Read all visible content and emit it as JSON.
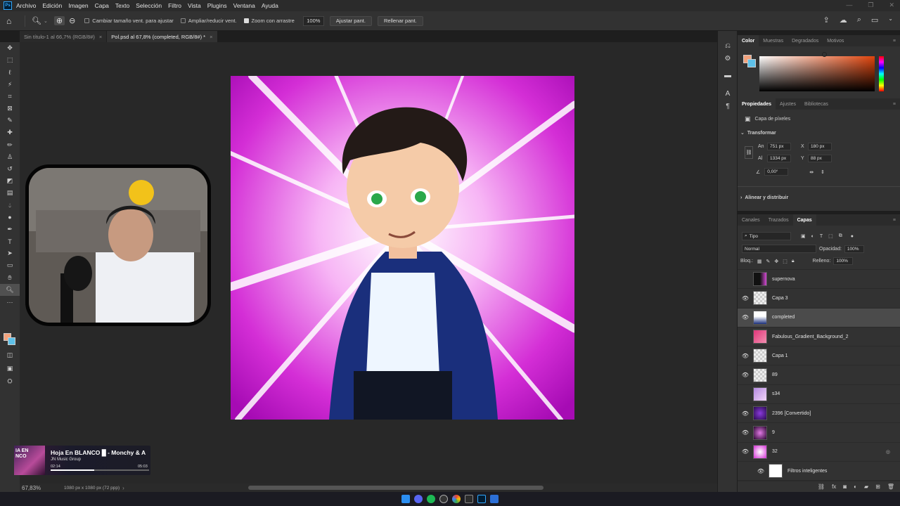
{
  "app": {
    "menu": [
      "Archivo",
      "Edición",
      "Imagen",
      "Capa",
      "Texto",
      "Selección",
      "Filtro",
      "Vista",
      "Plugins",
      "Ventana",
      "Ayuda"
    ]
  },
  "options": {
    "resize_windows": "Cambiar tamaño vent. para ajustar",
    "zoom_all": "Ampliar/reducir vent.",
    "scrubby_zoom": "Zoom con arrastre",
    "zoom_value": "100%",
    "fit_screen": "Ajustar pant.",
    "fill_screen": "Rellenar pant."
  },
  "tabs": [
    {
      "label": "Sin título-1 al 66,7% (RGB/8#)"
    },
    {
      "label": "Pol.psd al 67,8% (completed, RGB/8#) *"
    }
  ],
  "status": {
    "zoom": "67,83%",
    "dims": "1080 px x 1080 px (72 ppp)"
  },
  "music": {
    "song": "Hoja En BLANCO █ - Monchy & A",
    "artist": "JN Music Group",
    "elapsed": "02:14",
    "total": "05:03",
    "art_text": "IA EN\nNCO",
    "progress": 0.44
  },
  "color_panel": {
    "tabs": [
      "Color",
      "Muestras",
      "Degradados",
      "Motivos"
    ],
    "fg": "#f2a27c",
    "bg": "#5ec0e8"
  },
  "properties": {
    "tabs": [
      "Propiedades",
      "Ajustes",
      "Bibliotecas"
    ],
    "layer_kind": "Capa de píxeles",
    "transform_title": "Transformar",
    "w_label": "An",
    "w": "751 px",
    "x_label": "X",
    "x": "180 px",
    "h_label": "Al",
    "h": "1334 px",
    "y_label": "Y",
    "y": "88 px",
    "angle": "0,00°",
    "align_title": "Alinear y distribuir"
  },
  "layers_panel": {
    "tabs": [
      "Canales",
      "Trazados",
      "Capas"
    ],
    "filter": "Tipo",
    "blend": "Normal",
    "opacity_label": "Opacidad:",
    "opacity": "100%",
    "lock_label": "Bloq.:",
    "fill_label": "Relleno:",
    "fill": "100%",
    "layers": [
      {
        "name": "supernova",
        "visible": false
      },
      {
        "name": "Capa 3",
        "visible": true
      },
      {
        "name": "completed",
        "visible": true,
        "selected": true
      },
      {
        "name": "Fabulous_Gradient_Background_2",
        "visible": false
      },
      {
        "name": "Capa 1",
        "visible": true
      },
      {
        "name": "89",
        "visible": true
      },
      {
        "name": "s34",
        "visible": false
      },
      {
        "name": "2396 [Convertido]",
        "visible": true
      },
      {
        "name": "9",
        "visible": true
      },
      {
        "name": "32",
        "visible": true
      }
    ],
    "smart_filters": "Filtros inteligentes"
  }
}
